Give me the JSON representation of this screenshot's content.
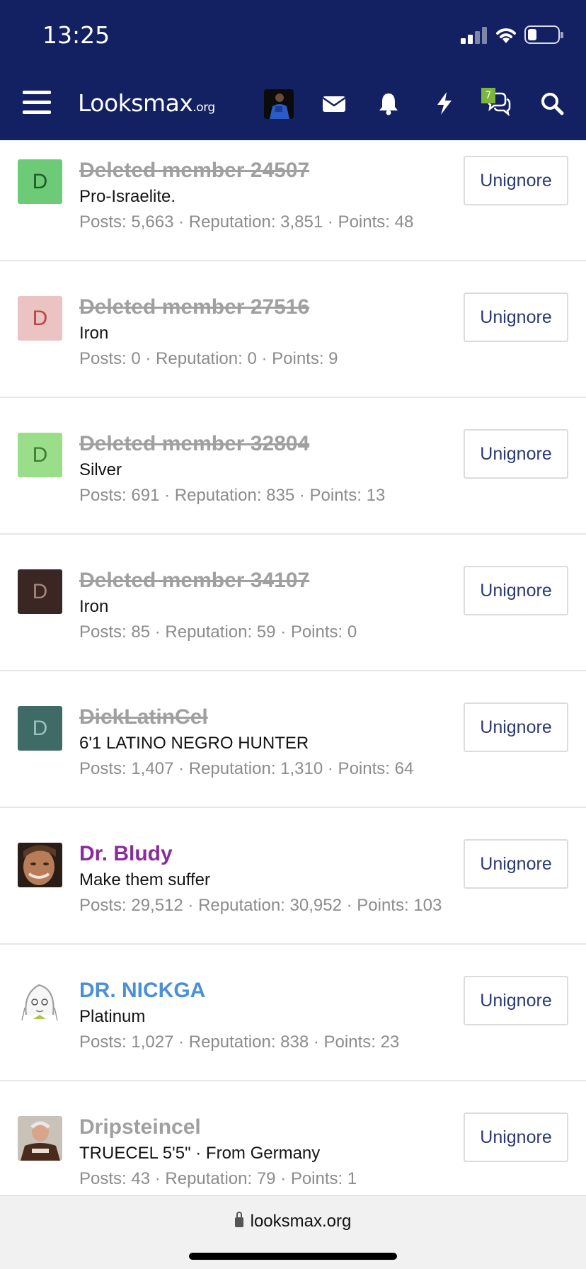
{
  "status_bar": {
    "time": "13:25"
  },
  "nav": {
    "logo_main": "Looksmax",
    "logo_tld": ".org",
    "conversations_badge": "7"
  },
  "members": [
    {
      "name": "Deleted member 24507",
      "deleted": true,
      "title": "Pro-Israelite.",
      "stats": "Posts: 5,663 · Reputation: 3,851 · Points: 48",
      "avatar_letter": "D",
      "avatar_bg": "#6dcb78",
      "avatar_fg": "#1f5a28",
      "button": "Unignore"
    },
    {
      "name": "Deleted member 27516",
      "deleted": true,
      "title": "Iron",
      "stats": "Posts: 0 · Reputation: 0 · Points: 9",
      "avatar_letter": "D",
      "avatar_bg": "#ebc3c3",
      "avatar_fg": "#b8433f",
      "button": "Unignore"
    },
    {
      "name": "Deleted member 32804",
      "deleted": true,
      "title": "Silver",
      "stats": "Posts: 691 · Reputation: 835 · Points: 13",
      "avatar_letter": "D",
      "avatar_bg": "#9bde8a",
      "avatar_fg": "#3e7a33",
      "button": "Unignore"
    },
    {
      "name": "Deleted member 34107",
      "deleted": true,
      "title": "Iron",
      "stats": "Posts: 85 · Reputation: 59 · Points: 0",
      "avatar_letter": "D",
      "avatar_bg": "#3a2622",
      "avatar_fg": "#a8857a",
      "button": "Unignore"
    },
    {
      "name": "DickLatinCel",
      "deleted": true,
      "title": "6'1 LATINO NEGRO HUNTER",
      "stats": "Posts: 1,407 · Reputation: 1,310 · Points: 64",
      "avatar_letter": "D",
      "avatar_bg": "#3f6b67",
      "avatar_fg": "#9ac2bd",
      "button": "Unignore"
    },
    {
      "name": "Dr. Bludy",
      "deleted": false,
      "name_color": "#8a2a9c",
      "title": "Make them suffer",
      "stats": "Posts: 29,512 · Reputation: 30,952 · Points: 103",
      "avatar_letter": "",
      "avatar_icon": "photo-avatar-face-icon",
      "button": "Unignore"
    },
    {
      "name": "DR. NICKGA",
      "deleted": false,
      "name_color": "#4a90d9",
      "title": "Platinum",
      "stats": "Posts: 1,027 · Reputation: 838 · Points: 23",
      "avatar_letter": "",
      "avatar_icon": "anime-sketch-avatar-icon",
      "button": "Unignore"
    },
    {
      "name": "Dripsteincel",
      "deleted": false,
      "name_color": "#a0a0a0",
      "title": "TRUECEL 5'5\" · From Germany",
      "stats": "Posts: 43 · Reputation: 79 · Points: 1",
      "avatar_letter": "",
      "avatar_icon": "photo-avatar-man-icon",
      "button": "Unignore"
    }
  ],
  "footer": {
    "url": "looksmax.org"
  }
}
